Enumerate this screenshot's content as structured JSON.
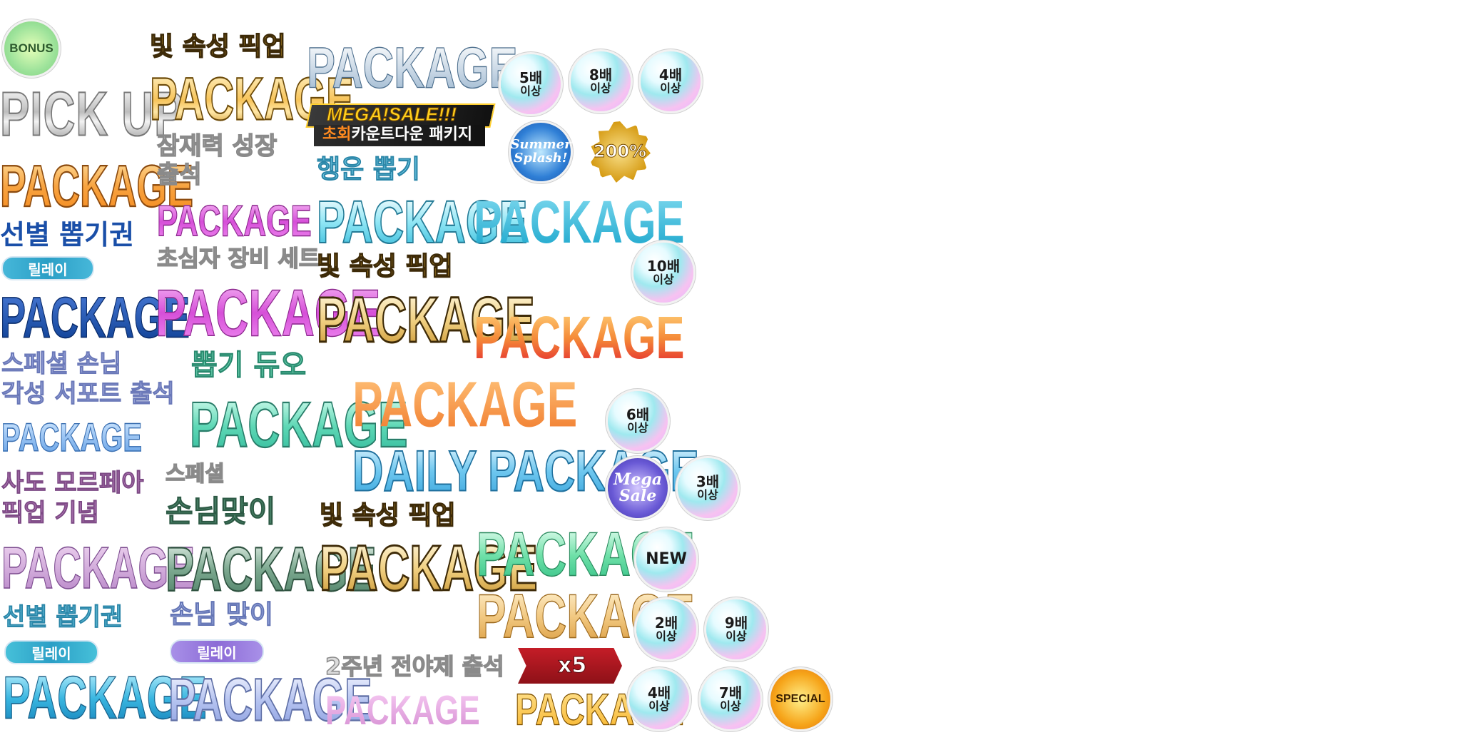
{
  "labels": {
    "bonus": "BONUS",
    "pickup": "PICK UP",
    "package": "PACKAGE",
    "daily_package": "DAILY PACKAGE",
    "mega_sale_banner": "MEGA!SALE!!!",
    "mega_sale_sub_prefix": "초회",
    "mega_sale_sub": "카운트다운 패키지",
    "light_pickup": "빛 속성 픽업",
    "potential_growth": "잠재력 성장",
    "attendance": "출석",
    "lucky_draw": "행운 뽑기",
    "selection_ticket": "선별 뽑기권",
    "relay": "릴레이",
    "beginner_set": "초심자 장비 세트",
    "special_guest": "스페셜 손님",
    "awaken_support": "각성 서포트 출석",
    "draw_duo": "뽑기 듀오",
    "sado": "사도 모르페아",
    "pickup_memorial": "픽업 기념",
    "special": "스페셜",
    "welcome_guest": "손님맞이",
    "welcome_guest2": "손님 맞이",
    "anniv": "2주년 전야제 출석",
    "x5": "x5",
    "summer_splash_1": "Summer",
    "summer_splash_2": "Splash!",
    "mega_sale_1": "Mega",
    "mega_sale_2": "Sale",
    "percent_200": "200%",
    "special_badge": "SPECIAL",
    "new_badge": "NEW",
    "above": "이상"
  },
  "multiplier_badges": [
    "5배",
    "8배",
    "4배",
    "10배",
    "6배",
    "3배",
    "2배",
    "9배",
    "4배",
    "7배"
  ],
  "colors": {
    "relay_cyan": "#2b9fc6",
    "relay_purple": "#8c6bd6",
    "x5_red": "#a0171f",
    "mega_bg": "#1a1a1a",
    "mega_yellow": "#ffd21f",
    "gold_badge": "#d59a12"
  }
}
